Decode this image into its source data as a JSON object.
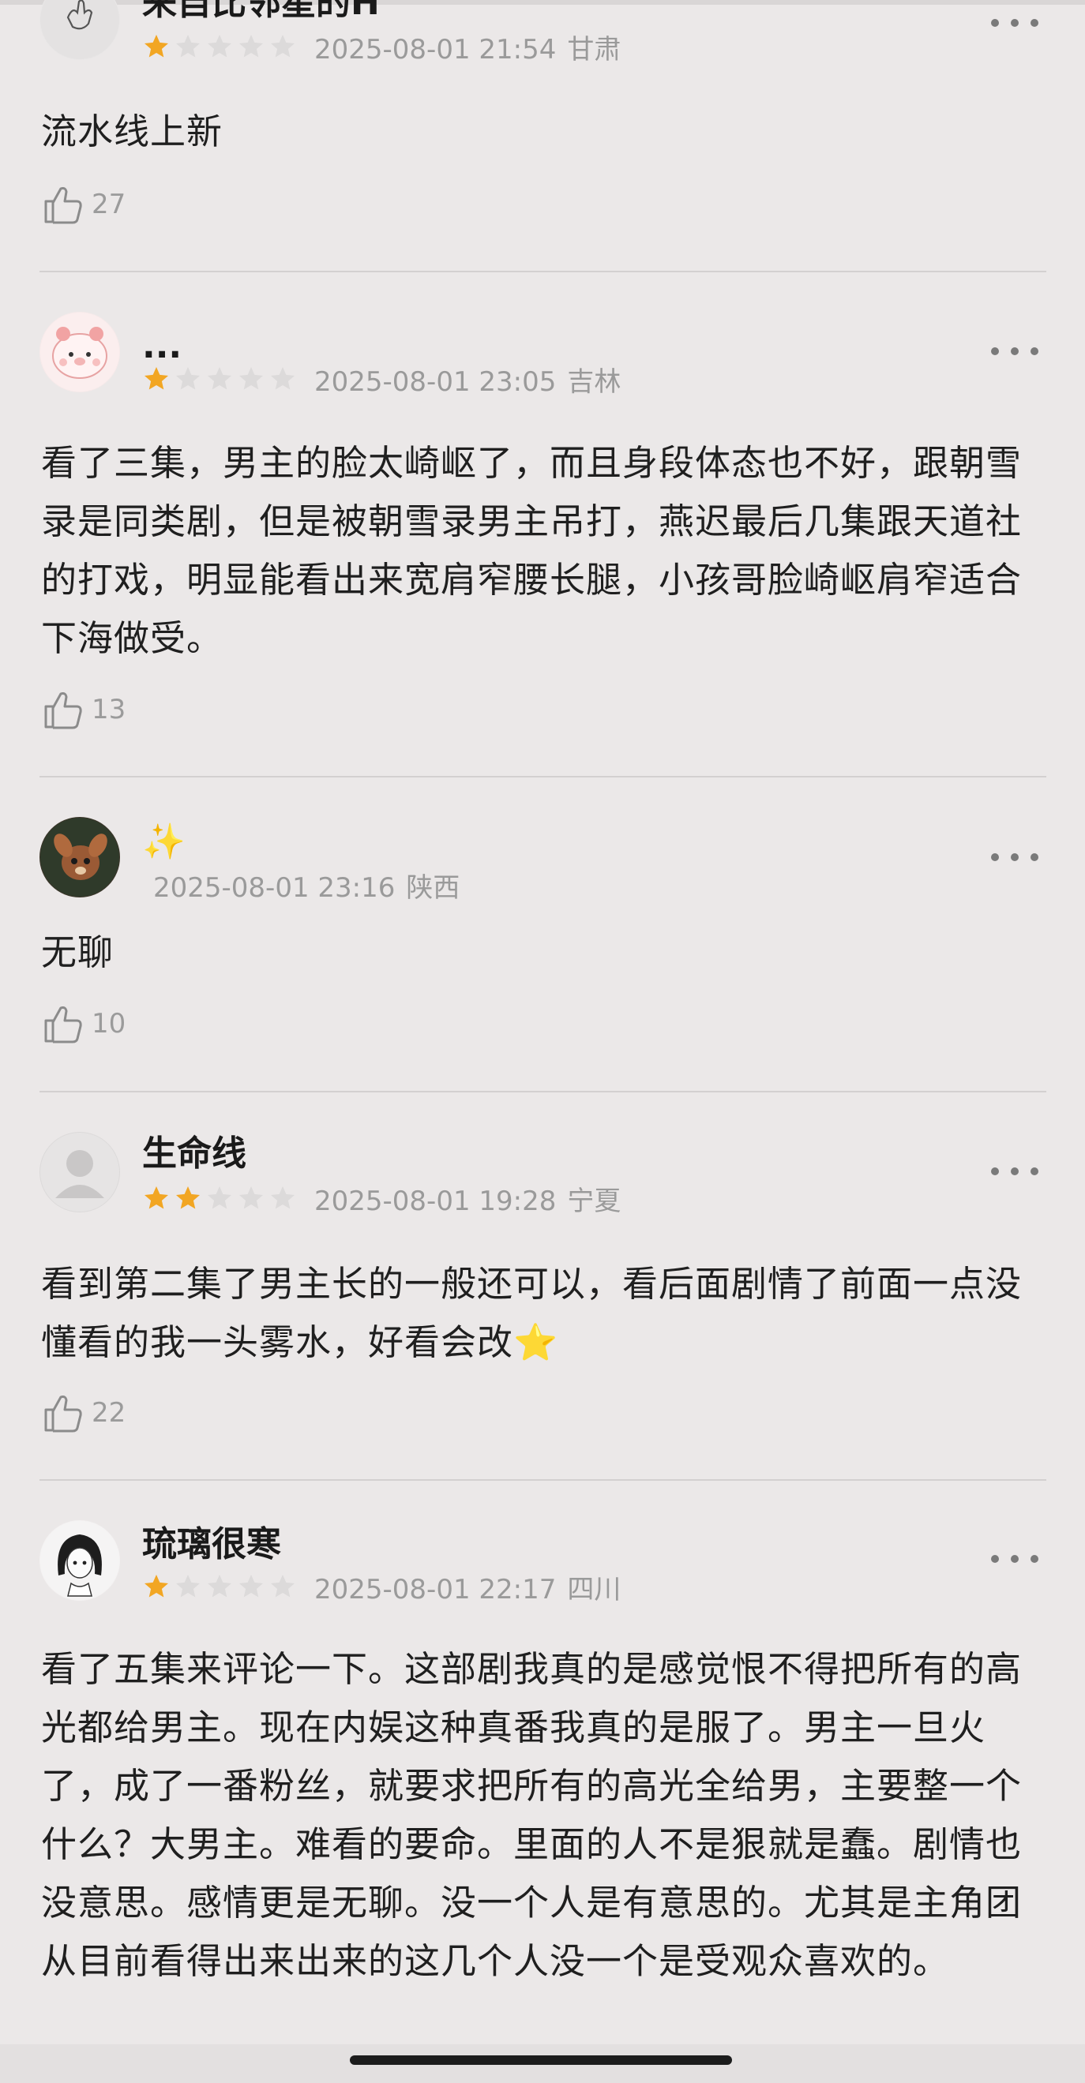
{
  "reviews": [
    {
      "username": "来自比邻星的H",
      "rating": 1,
      "date": "2025-08-01 21:54",
      "location": "甘肃",
      "content": "流水线上新",
      "likes": "27",
      "avatar_icon": "hand-sketch-avatar-icon"
    },
    {
      "username": "...",
      "rating": 1,
      "date": "2025-08-01 23:05",
      "location": "吉林",
      "content": "看了三集，男主的脸太崎岖了，而且身段体态也不好，跟朝雪录是同类剧，但是被朝雪录男主吊打，燕迟最后几集跟天道社的打戏，明显能看出来宽肩窄腰长腿，小孩哥脸崎岖肩窄适合下海做受。",
      "likes": "13",
      "avatar_icon": "pink-pig-avatar-icon"
    },
    {
      "username": "✨",
      "rating": 0,
      "date": "2025-08-01 23:16",
      "location": "陕西",
      "content": "无聊",
      "likes": "10",
      "avatar_icon": "fawn-avatar-icon"
    },
    {
      "username": "生命线",
      "rating": 2,
      "date": "2025-08-01 19:28",
      "location": "宁夏",
      "content": "看到第二集了男主长的一般还可以，看后面剧情了前面一点没懂看的我一头雾水，好看会改⭐",
      "likes": "22",
      "avatar_icon": "default-user-avatar-icon"
    },
    {
      "username": "琉璃很寒",
      "rating": 1,
      "date": "2025-08-01 22:17",
      "location": "四川",
      "content": "看了五集来评论一下。这部剧我真的是感觉恨不得把所有的高光都给男主。现在内娱这种真番我真的是服了。男主一旦火了，成了一番粉丝，就要求把所有的高光全给男，主要整一个什么？大男主。难看的要命。里面的人不是狠就是蠢。剧情也没意思。感情更是无聊。没一个人是有意思的。尤其是主角团从目前看得出来出来的这几个人没一个是受观众喜欢的。",
      "likes": "",
      "avatar_icon": "anime-girl-avatar-icon"
    }
  ],
  "colors": {
    "background": "#ebe8e8",
    "star_filled": "#f2a623",
    "star_empty": "#dcdada",
    "meta_text": "#9a9a9a"
  }
}
